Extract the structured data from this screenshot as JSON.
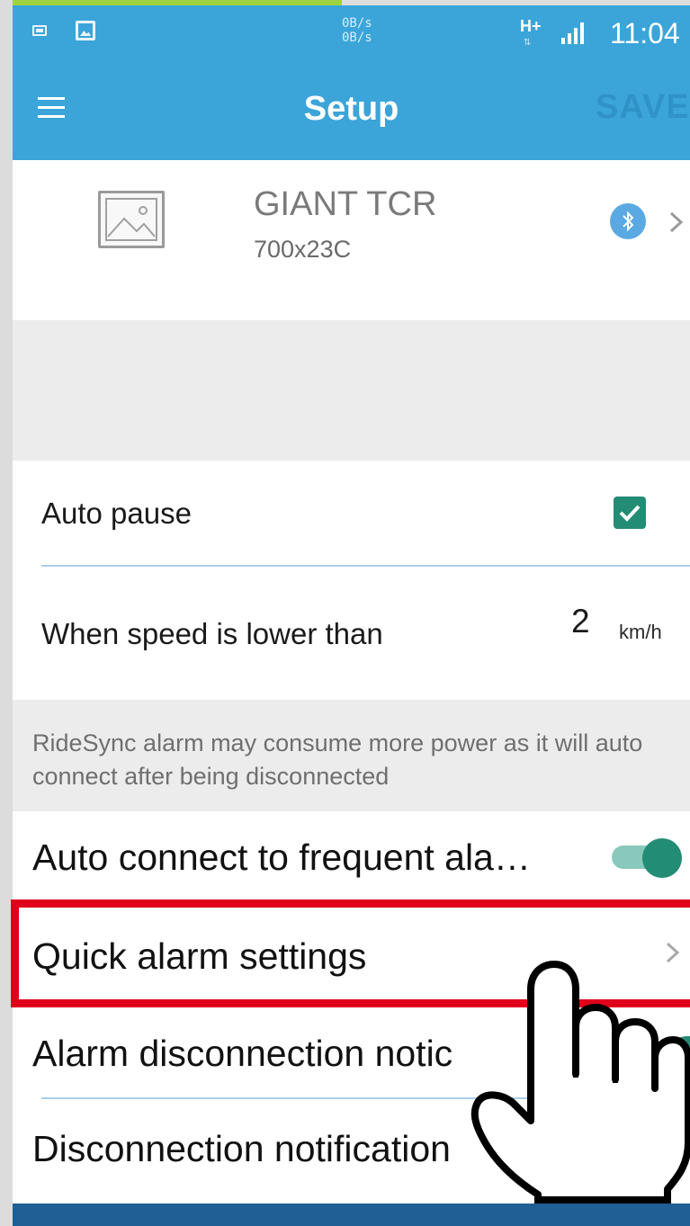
{
  "status_bar": {
    "speed_up": "0B/s",
    "speed_down": "0B/s",
    "network": "H+",
    "time": "11:04"
  },
  "app_bar": {
    "title": "Setup",
    "save_label": "SAVE"
  },
  "bike": {
    "name": "GIANT TCR",
    "tire_size": "700x23C"
  },
  "auto_pause": {
    "label": "Auto pause",
    "checked": true
  },
  "speed_threshold": {
    "label": "When speed is lower than",
    "value": "2",
    "unit": "km/h"
  },
  "note": {
    "text": "RideSync alarm may consume more power as it will auto connect after being disconnected"
  },
  "settings": {
    "auto_connect_label": "Auto connect to frequent ala…",
    "auto_connect_on": true,
    "quick_alarm_label": "Quick alarm settings",
    "alarm_disconnection_label": "Alarm disconnection notic",
    "disconnection_notification_label": "Disconnection notification"
  },
  "icons": {
    "menu": "menu-icon",
    "bluetooth": "bluetooth-icon",
    "chevron": "chevron-right-icon",
    "pointer": "hand-pointer-icon"
  },
  "colors": {
    "primary": "#3ba5d9",
    "accent": "#238c74",
    "highlight": "#e0001b"
  }
}
